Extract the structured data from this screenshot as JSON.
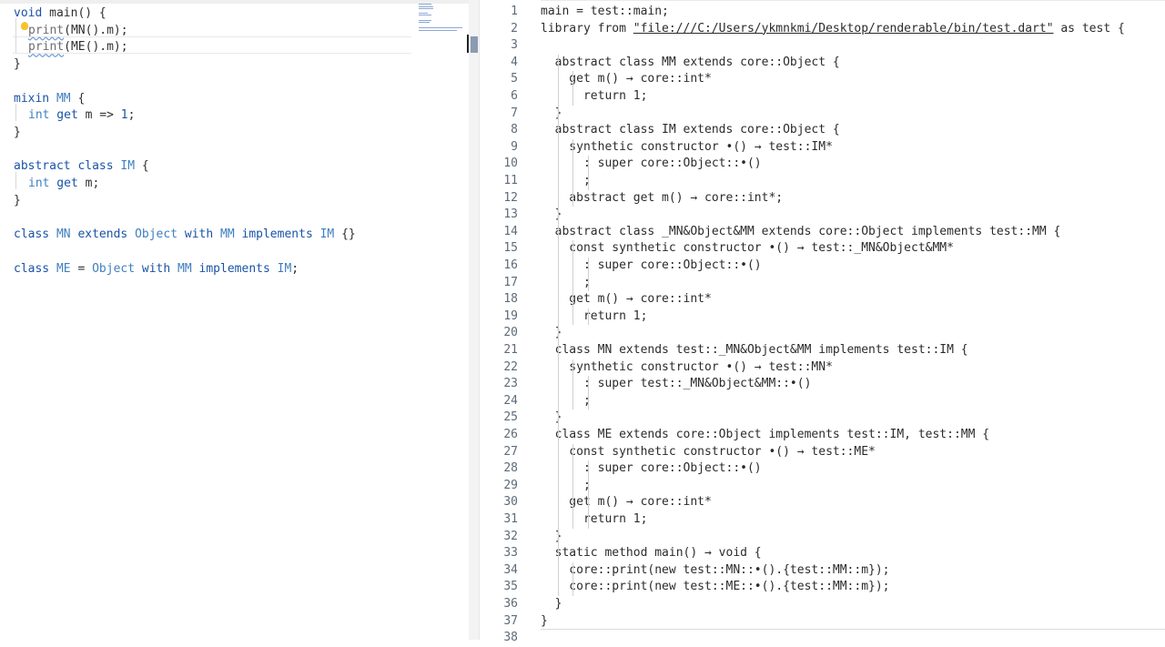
{
  "left_editor": {
    "lines": [
      [
        {
          "t": "void",
          "c": "kw"
        },
        {
          "t": " main() {",
          "c": "plain"
        }
      ],
      [
        {
          "t": "print",
          "c": "fn",
          "sq": true
        },
        {
          "t": "(MN().m);",
          "c": "plain"
        }
      ],
      [
        {
          "t": "print",
          "c": "fn",
          "sq": true
        },
        {
          "t": "(ME",
          "c": "plain"
        },
        {
          "t": "()",
          "c": "plain"
        },
        {
          "t": ".m);",
          "c": "plain"
        }
      ],
      [
        {
          "t": "}",
          "c": "plain"
        }
      ],
      [
        {
          "t": "",
          "c": "plain"
        }
      ],
      [
        {
          "t": "mixin",
          "c": "kw"
        },
        {
          "t": " MM ",
          "c": "type"
        },
        {
          "t": "{",
          "c": "plain"
        }
      ],
      [
        {
          "t": "int",
          "c": "type"
        },
        {
          "t": " get",
          "c": "kw"
        },
        {
          "t": " m => ",
          "c": "plain"
        },
        {
          "t": "1",
          "c": "num"
        },
        {
          "t": ";",
          "c": "plain"
        }
      ],
      [
        {
          "t": "}",
          "c": "plain"
        }
      ],
      [
        {
          "t": "",
          "c": "plain"
        }
      ],
      [
        {
          "t": "abstract",
          "c": "kw"
        },
        {
          "t": " class",
          "c": "kw"
        },
        {
          "t": " IM ",
          "c": "type"
        },
        {
          "t": "{",
          "c": "plain"
        }
      ],
      [
        {
          "t": "int",
          "c": "type"
        },
        {
          "t": " get",
          "c": "kw"
        },
        {
          "t": " m;",
          "c": "plain"
        }
      ],
      [
        {
          "t": "}",
          "c": "plain"
        }
      ],
      [
        {
          "t": "",
          "c": "plain"
        }
      ],
      [
        {
          "t": "class",
          "c": "kw"
        },
        {
          "t": " MN ",
          "c": "type"
        },
        {
          "t": "extends",
          "c": "kw"
        },
        {
          "t": " Object ",
          "c": "type"
        },
        {
          "t": "with",
          "c": "kw"
        },
        {
          "t": " MM ",
          "c": "type"
        },
        {
          "t": "implements",
          "c": "kw"
        },
        {
          "t": " IM ",
          "c": "type"
        },
        {
          "t": "{}",
          "c": "plain"
        }
      ],
      [
        {
          "t": "",
          "c": "plain"
        }
      ],
      [
        {
          "t": "class",
          "c": "kw"
        },
        {
          "t": " ME ",
          "c": "type"
        },
        {
          "t": "= ",
          "c": "plain"
        },
        {
          "t": "Object ",
          "c": "type"
        },
        {
          "t": "with",
          "c": "kw"
        },
        {
          "t": " MM ",
          "c": "type"
        },
        {
          "t": "implements",
          "c": "kw"
        },
        {
          "t": " IM",
          "c": "type"
        },
        {
          "t": ";",
          "c": "plain"
        }
      ]
    ]
  },
  "right_editor": {
    "line_numbers": [
      "1",
      "2",
      "3",
      "4",
      "5",
      "6",
      "7",
      "8",
      "9",
      "10",
      "11",
      "12",
      "13",
      "14",
      "15",
      "16",
      "17",
      "18",
      "19",
      "20",
      "21",
      "22",
      "23",
      "24",
      "25",
      "26",
      "27",
      "28",
      "29",
      "30",
      "31",
      "32",
      "33",
      "34",
      "35",
      "36",
      "37",
      "38"
    ],
    "lines": [
      "main = test::main;",
      "library from \"file:///C:/Users/ykmnkmi/Desktop/renderable/bin/test.dart\" as test {",
      "",
      "  abstract class MM extends core::Object {",
      "    get m() → core::int*",
      "      return 1;",
      "  }",
      "  abstract class IM extends core::Object {",
      "    synthetic constructor •() → test::IM*",
      "      : super core::Object::•()",
      "      ;",
      "    abstract get m() → core::int*;",
      "  }",
      "  abstract class _MN&Object&MM extends core::Object implements test::MM {",
      "    const synthetic constructor •() → test::_MN&Object&MM*",
      "      : super core::Object::•()",
      "      ;",
      "    get m() → core::int*",
      "      return 1;",
      "  }",
      "  class MN extends test::_MN&Object&MM implements test::IM {",
      "    synthetic constructor •() → test::MN*",
      "      : super test::_MN&Object&MM::•()",
      "      ;",
      "  }",
      "  class ME extends core::Object implements test::IM, test::MM {",
      "    const synthetic constructor •() → test::ME*",
      "      : super core::Object::•()",
      "      ;",
      "    get m() → core::int*",
      "      return 1;",
      "  }",
      "  static method main() → void {",
      "    core::print(new test::MN::•().{test::MM::m});",
      "    core::print(new test::ME::•().{test::MM::m});",
      "  }",
      "}",
      ""
    ]
  },
  "colors": {
    "keyword": "#1a53a6",
    "type": "#3f7fbf",
    "text": "#2b2b2b",
    "line_number": "#5f6a78",
    "lightbulb": "#f5c232"
  }
}
